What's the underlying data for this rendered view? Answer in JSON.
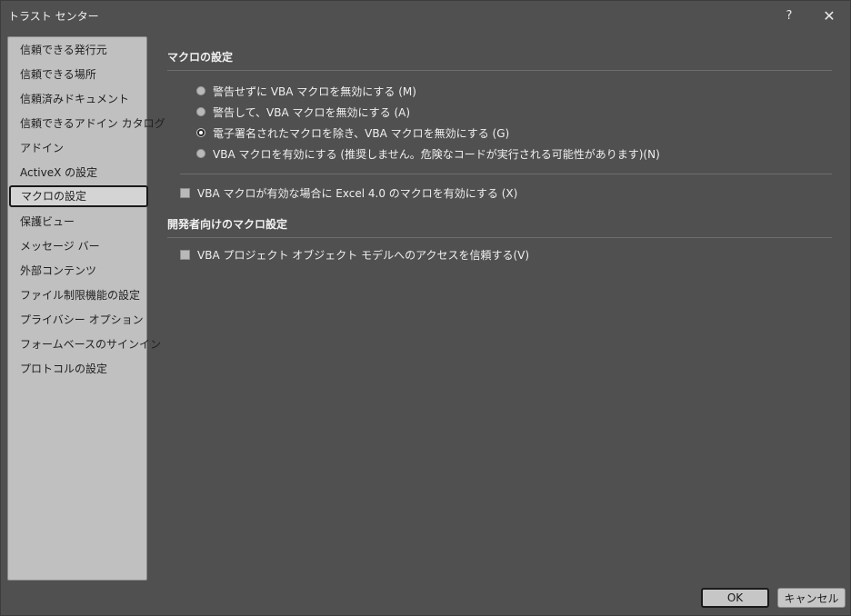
{
  "window": {
    "title": "トラスト センター",
    "help_label": "?",
    "close_label": "✕"
  },
  "sidebar": {
    "items": [
      {
        "label": "信頼できる発行元"
      },
      {
        "label": "信頼できる場所"
      },
      {
        "label": "信頼済みドキュメント"
      },
      {
        "label": "信頼できるアドイン カタログ"
      },
      {
        "label": "アドイン"
      },
      {
        "label": "ActiveX の設定"
      },
      {
        "label": "マクロの設定",
        "selected": true
      },
      {
        "label": "保護ビュー"
      },
      {
        "label": "メッセージ バー"
      },
      {
        "label": "外部コンテンツ"
      },
      {
        "label": "ファイル制限機能の設定"
      },
      {
        "label": "プライバシー オプション"
      },
      {
        "label": "フォームベースのサインイン"
      },
      {
        "label": "プロトコルの設定"
      }
    ]
  },
  "macro_settings": {
    "title": "マクロの設定",
    "options": [
      {
        "label": "警告せずに VBA マクロを無効にする (M)",
        "checked": false
      },
      {
        "label": "警告して、VBA マクロを無効にする (A)",
        "checked": false
      },
      {
        "label": "電子署名されたマクロを除き、VBA マクロを無効にする (G)",
        "checked": true
      },
      {
        "label": "VBA マクロを有効にする (推奨しません。危険なコードが実行される可能性があります)(N)",
        "checked": false
      }
    ],
    "excel4_label": "VBA マクロが有効な場合に Excel 4.0 のマクロを有効にする (X)",
    "excel4_checked": false
  },
  "developer_settings": {
    "title": "開発者向けのマクロ設定",
    "vba_access_label": "VBA プロジェクト オブジェクト モデルへのアクセスを信頼する(V)",
    "vba_access_checked": false
  },
  "footer": {
    "ok_label": "OK",
    "cancel_label": "キャンセル"
  }
}
